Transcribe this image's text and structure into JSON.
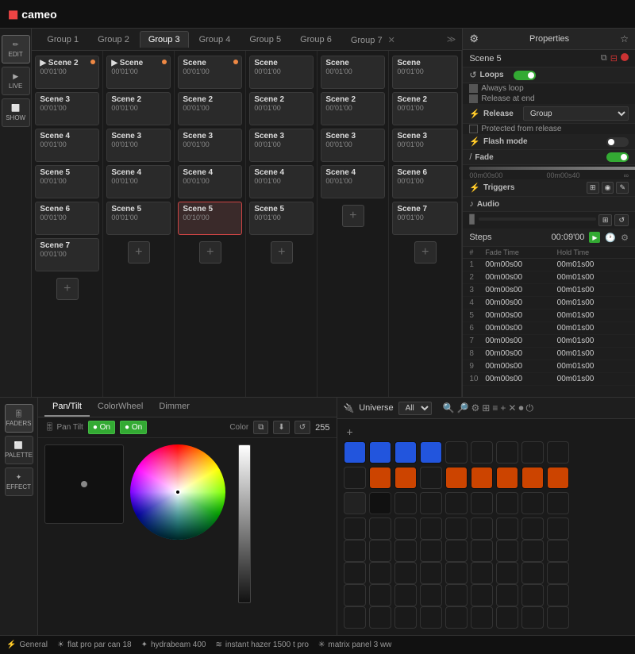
{
  "app": {
    "logo": "cameo",
    "logo_icon": "◼"
  },
  "tabs": [
    {
      "label": "Group 1",
      "active": false
    },
    {
      "label": "Group 2",
      "active": false
    },
    {
      "label": "Group 3",
      "active": true
    },
    {
      "label": "Group 4",
      "active": false
    },
    {
      "label": "Group 5",
      "active": false
    },
    {
      "label": "Group 6",
      "active": false
    },
    {
      "label": "Group 7",
      "active": false,
      "closable": true
    }
  ],
  "sidebar_buttons": [
    {
      "icon": "↕",
      "label": "EDIT",
      "active": true
    },
    {
      "icon": "▶",
      "label": "LIVE"
    },
    {
      "icon": "⬜",
      "label": "SHOW"
    }
  ],
  "groups": [
    {
      "scenes": [
        {
          "name": "Scene 2",
          "time": "00'01'00",
          "dot": "orange"
        },
        {
          "name": "Scene 3",
          "time": "00'01'00"
        },
        {
          "name": "Scene 4",
          "time": "00'01'00"
        },
        {
          "name": "Scene 5",
          "time": "00'01'00"
        },
        {
          "name": "Scene 6",
          "time": "00'01'00"
        },
        {
          "name": "Scene 7",
          "time": "00'01'00"
        }
      ]
    },
    {
      "scenes": [
        {
          "name": "Scene",
          "time": "00'01'00",
          "dot": "orange"
        },
        {
          "name": "Scene 2",
          "time": "00'01'00"
        },
        {
          "name": "Scene 3",
          "time": "00'01'00"
        },
        {
          "name": "Scene 4",
          "time": "00'01'00"
        },
        {
          "name": "Scene 5",
          "time": "00'01'00"
        }
      ]
    },
    {
      "scenes": [
        {
          "name": "Scene",
          "time": "00'01'00"
        },
        {
          "name": "Scene 2",
          "time": "00'01'00"
        },
        {
          "name": "Scene 3",
          "time": "00'01'00"
        },
        {
          "name": "Scene 4",
          "time": "00'01'00"
        },
        {
          "name": "Scene 5",
          "time": "00'10'00",
          "active": true
        }
      ]
    },
    {
      "scenes": [
        {
          "name": "Scene",
          "time": "00'01'00"
        },
        {
          "name": "Scene 2",
          "time": "00'01'00"
        },
        {
          "name": "Scene 3",
          "time": "00'01'00"
        },
        {
          "name": "Scene 4",
          "time": "00'01'00"
        },
        {
          "name": "Scene 5",
          "time": "00'01'00"
        }
      ]
    },
    {
      "scenes": [
        {
          "name": "Scene",
          "time": "00'01'00"
        },
        {
          "name": "Scene 2",
          "time": "00'01'00"
        },
        {
          "name": "Scene 3",
          "time": "00'01'00"
        },
        {
          "name": "Scene 4",
          "time": "00'01'00"
        }
      ]
    },
    {
      "scenes": [
        {
          "name": "Scene",
          "time": "00'01'00"
        },
        {
          "name": "Scene 2",
          "time": "00'01'00"
        },
        {
          "name": "Scene 3",
          "time": "00'01'00"
        },
        {
          "name": "Scene 6",
          "time": "00'01'00"
        },
        {
          "name": "Scene 7",
          "time": "00'01'00"
        }
      ]
    }
  ],
  "properties": {
    "title": "Properties",
    "scene_name": "Scene 5",
    "loops_label": "↺ Loops",
    "always_loop": true,
    "release_at_end": true,
    "release_label": "⚡ Release",
    "release_value": "Group",
    "protected_label": "Protected from release",
    "flash_label": "⚡ Flash mode",
    "fade_label": "/ Fade",
    "triggers_label": "⚡ Triggers",
    "audio_label": "♪ Audio",
    "steps_label": "Steps",
    "steps_time": "00:09'00",
    "col_num": "#",
    "col_fade": "Fade Time",
    "col_hold": "Hold Time",
    "steps": [
      {
        "num": 1,
        "fade": "00m00s00",
        "hold": "00m01s00"
      },
      {
        "num": 2,
        "fade": "00m00s00",
        "hold": "00m01s00"
      },
      {
        "num": 3,
        "fade": "00m00s00",
        "hold": "00m01s00"
      },
      {
        "num": 4,
        "fade": "00m00s00",
        "hold": "00m01s00"
      },
      {
        "num": 5,
        "fade": "00m00s00",
        "hold": "00m01s00"
      },
      {
        "num": 6,
        "fade": "00m00s00",
        "hold": "00m01s00"
      },
      {
        "num": 7,
        "fade": "00m00s00",
        "hold": "00m01s00"
      },
      {
        "num": 8,
        "fade": "00m00s00",
        "hold": "00m01s00"
      },
      {
        "num": 9,
        "fade": "00m00s00",
        "hold": "00m01s00"
      },
      {
        "num": 10,
        "fade": "00m00s00",
        "hold": "00m01s00"
      }
    ]
  },
  "bottom": {
    "tabs": [
      "Pan/Tilt",
      "ColorWheel",
      "Dimmer"
    ],
    "active_tab": "Pan/Tilt",
    "on_label": "On",
    "color_label": "Color",
    "dimmer_value": "255"
  },
  "universe": {
    "label": "Universe",
    "value": "All"
  },
  "status_bar": {
    "general_label": "General",
    "devices": [
      {
        "icon": "☀",
        "name": "flat pro par can 18"
      },
      {
        "icon": "✦",
        "name": "hydrabeam 400"
      },
      {
        "icon": "≋",
        "name": "instant hazer 1500 t pro"
      },
      {
        "icon": "✳",
        "name": "matrix panel 3 ww"
      }
    ]
  },
  "launchpad": {
    "top_row": [
      "blue",
      "blue",
      "blue",
      "blue",
      "empty",
      "empty",
      "empty",
      "empty",
      "empty"
    ],
    "row2": [
      "empty",
      "orange",
      "orange",
      "empty",
      "orange",
      "orange",
      "orange",
      "orange",
      "orange"
    ],
    "row3": [
      "empty",
      "dark",
      "empty",
      "empty",
      "empty",
      "empty",
      "empty",
      "empty",
      "empty"
    ],
    "grid": 7,
    "grid_cols": 9
  }
}
